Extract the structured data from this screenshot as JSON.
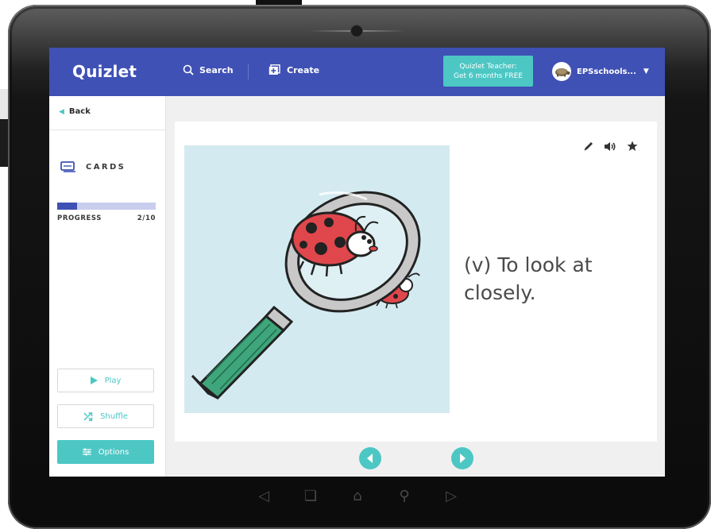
{
  "app": {
    "logo": "Quizlet",
    "search_label": "Search",
    "create_label": "Create",
    "promo_line1": "Quizlet Teacher:",
    "promo_line2": "Get 6 months FREE",
    "user_name": "EPSschools..."
  },
  "sidebar": {
    "back_label": "Back",
    "mode_label": "CARDS",
    "progress_label": "PROGRESS",
    "progress_text": "2/10",
    "progress_fraction": 0.2,
    "buttons": {
      "play": "Play",
      "shuffle": "Shuffle",
      "options": "Options"
    }
  },
  "card": {
    "definition": "(v) To look at closely."
  },
  "colors": {
    "brand": "#3f51b5",
    "accent": "#4cc7c4",
    "image_bg": "#d3eaf0"
  }
}
